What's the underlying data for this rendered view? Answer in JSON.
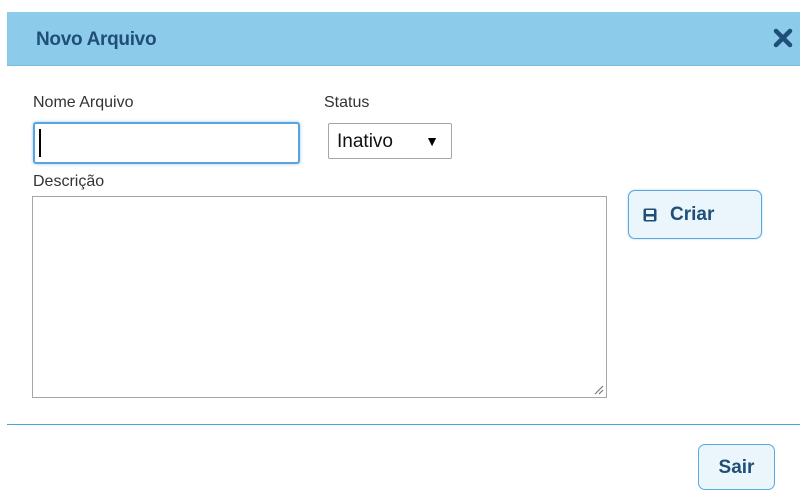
{
  "dialog": {
    "title": "Novo Arquivo",
    "close_icon": "close-icon"
  },
  "form": {
    "name_label": "Nome Arquivo",
    "name_value": "",
    "status_label": "Status",
    "status_selected": "Inativo",
    "status_arrow": "▼",
    "description_label": "Descrição",
    "description_value": ""
  },
  "actions": {
    "create_label": "Criar",
    "create_icon": "save-icon",
    "exit_label": "Sair"
  },
  "colors": {
    "titlebar_bg": "#8dcbea",
    "title_text": "#1f4e79",
    "input_focus_border": "#5ba3dc",
    "button_bg": "#eaf5fc",
    "button_border": "#5aa8dd",
    "divider": "#4aa3d9"
  }
}
